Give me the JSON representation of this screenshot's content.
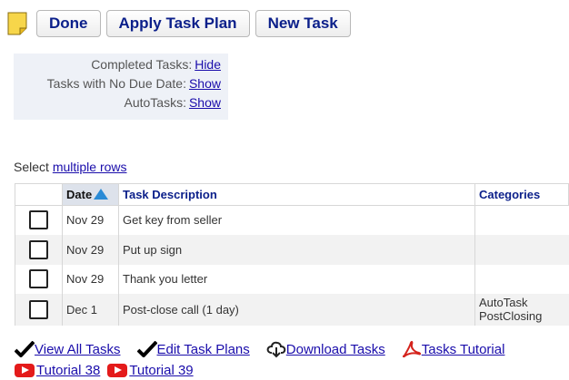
{
  "toolbar": {
    "done_label": "Done",
    "apply_label": "Apply Task Plan",
    "new_label": "New Task"
  },
  "filters": [
    {
      "label": "Completed Tasks:",
      "action": "Hide"
    },
    {
      "label": "Tasks with No Due Date:",
      "action": "Show"
    },
    {
      "label": "AutoTasks:",
      "action": "Show"
    }
  ],
  "select": {
    "prefix": "Select",
    "link": "multiple rows"
  },
  "table": {
    "headers": {
      "date": "Date",
      "description": "Task Description",
      "categories": "Categories"
    },
    "rows": [
      {
        "date": "Nov 29",
        "description": "Get key from seller",
        "cat1": "",
        "cat2": ""
      },
      {
        "date": "Nov 29",
        "description": "Put up sign",
        "cat1": "",
        "cat2": ""
      },
      {
        "date": "Nov 29",
        "description": "Thank you letter",
        "cat1": "",
        "cat2": ""
      },
      {
        "date": "Dec 1",
        "description": "Post-close call (1 day)",
        "cat1": "AutoTask",
        "cat2": "PostClosing"
      }
    ]
  },
  "links": {
    "view_all": "View All Tasks",
    "edit_plans": "Edit Task Plans",
    "download": "Download Tasks",
    "tutorial": "Tasks Tutorial",
    "tut38": "Tutorial 38",
    "tut39": "Tutorial 39"
  },
  "icons": {
    "note": "sticky-note-icon",
    "check": "checkmark-icon",
    "download": "cloud-download-icon",
    "pdf": "acrobat-icon",
    "youtube": "youtube-icon"
  },
  "colors": {
    "link": "#1a0dab",
    "header_text": "#0b1f8a",
    "sort_arrow": "#2a8bd6",
    "youtube": "#e41b1b",
    "pdf": "#d4231c"
  }
}
